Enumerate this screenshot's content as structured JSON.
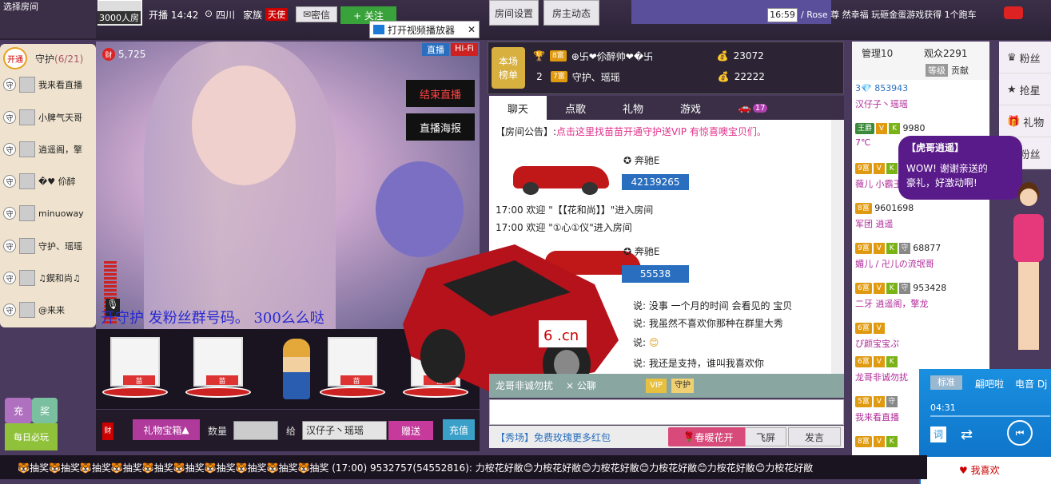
{
  "topbar": {
    "choose_room": "选择房间",
    "room_capacity": "3000人房",
    "live_time": "开播 14:42",
    "location": "四川",
    "family_label": "家族",
    "family_tag": "天使",
    "message_btn": "密信",
    "follow_btn": "+ 关注",
    "room_settings": "房间设置",
    "host_news": "房主动态",
    "clock": "16:59",
    "ticker": "/ Rose 尊 然幸福 玩砸金蛋游戏获得 1个跑车"
  },
  "player_popup": {
    "open_player": "打开视频播放器"
  },
  "guard": {
    "open_btn": "开通",
    "title": "守护",
    "count": "(6/21)",
    "members": [
      {
        "tag": "守",
        "name": "我来看直播"
      },
      {
        "tag": "守",
        "name": "小脾气天哥"
      },
      {
        "tag": "守",
        "name": "逍遥阁，擎"
      },
      {
        "tag": "守",
        "name": "�♥︎ 伱醉"
      },
      {
        "tag": "守",
        "name": "minuoway"
      },
      {
        "tag": "守",
        "name": "守护、瑶瑶"
      },
      {
        "tag": "守",
        "name": "♫鍥和尚♫"
      },
      {
        "tag": "守",
        "name": "@来来"
      }
    ]
  },
  "video": {
    "wealth_icon": "财",
    "wealth": "5,725",
    "live_badge": "直播",
    "hifi_badge": "Hi-Fi",
    "end_live": "结束直播",
    "live_poster": "直播海报",
    "subtitle": "开守护 发粉丝群号码。 300么么哒"
  },
  "gifts": {
    "items": [
      {
        "label": "苗"
      },
      {
        "label": "苗"
      },
      {
        "label": ""
      },
      {
        "label": "苗"
      },
      {
        "label": "苗"
      }
    ]
  },
  "controls": {
    "wealth_icon": "财",
    "gift_box": "礼物宝箱",
    "quantity_label": "数量",
    "to_label": "给",
    "recipient": "汉仔子丶瑶瑶",
    "send_btn": "赠送",
    "recharge_btn": "充值"
  },
  "left_small": {
    "recharge": "充",
    "lottery": "奖",
    "daily_play": "每日必玩"
  },
  "rank": {
    "title1": "本场",
    "title2": "榜单",
    "rows": [
      {
        "pos": "1",
        "level": "8富",
        "name": "⊕卐❤伱醉帅❤�卐",
        "coins": "23072"
      },
      {
        "pos": "2",
        "level": "7富",
        "name": "守护、瑶瑶",
        "coins": "22222"
      }
    ]
  },
  "tabs": [
    {
      "label": "聊天"
    },
    {
      "label": "点歌"
    },
    {
      "label": "礼物"
    },
    {
      "label": "游戏"
    },
    {
      "label": "17"
    }
  ],
  "chat": {
    "notice_prefix": "【房间公告】:",
    "notice": "点击这里找苗苗开通守护送VIP 有惊喜噢宝贝们。",
    "car1_name": "奔驰E",
    "car1_num": "42139265",
    "welcome1": "17:00 欢迎 \"【【花和尚】】\"进入房间",
    "welcome2": "17:00 欢迎 \"①心①仪\"进入房间",
    "car2_name": "奔驰E",
    "car2_num": "55538",
    "msg1": "说: 没事 一个月的时间 会看见的 宝贝",
    "msg2": "说: 我虽然不喜欢你那种在群里大秀",
    "msg3": "说:",
    "msg4": "说: 我还是支持，谁叫我喜欢你",
    "bar_user": "龙哥非诚勿扰",
    "bar_x": "× 公聊",
    "bar_vip": "VIP",
    "bar_guard": "守护",
    "show_text": "【秀场】免费玫瑰更多红包",
    "flower_btn": "春暖花开",
    "fly_btn": "飞屏",
    "send_btn": "发言"
  },
  "audience": {
    "manage_tab": "管理10",
    "viewers_tab": "观众2291",
    "level_tab": "等级",
    "contrib_tab": "贡献",
    "rows": [
      {
        "top": "3💎 853943",
        "name": "汉仔子丶瑶瑶"
      },
      {
        "level": "王爵",
        "num": "9980",
        "name": "7℃"
      },
      {
        "level": "9富",
        "num": "",
        "name": "薇儿 小霸王"
      },
      {
        "level": "8富",
        "num": "9601698",
        "name": "军团 逍遥"
      },
      {
        "level": "9富",
        "num": "68877",
        "name": "媚儿 / 卍儿の流氓哥"
      },
      {
        "level": "6富",
        "num": "953428",
        "name": "二牙 逍遥阁，擎龙"
      },
      {
        "level": "6富",
        "num": "",
        "name": "ぴ颜宝宝ぷ"
      },
      {
        "level": "6富",
        "num": "",
        "name": "龙哥非诚勿扰"
      },
      {
        "level": "5富",
        "num": "",
        "name": "我来看直播"
      },
      {
        "level": "8富",
        "num": "",
        "name": ""
      }
    ]
  },
  "side": {
    "items": [
      {
        "label": "粉丝"
      },
      {
        "label": "抢星"
      },
      {
        "label": "礼物"
      },
      {
        "label": "粉丝"
      }
    ]
  },
  "bubble": {
    "title": "【虎哥逍遥】",
    "line1": "WOW! 谢谢亲送的",
    "line2": "豪礼，好激动啊!"
  },
  "music": {
    "quality": "标准",
    "song1": "翩吧啦",
    "song2": "电音 Dj",
    "time": "04:31",
    "like": "我喜欢"
  },
  "marquee": {
    "text": "🐯抽奖🐯抽奖🐯抽奖🐯抽奖🐯抽奖🐯抽奖🐯抽奖🐯抽奖🐯抽奖🐯抽奖 (17:00)  9532757(54552816): 力桉花好敝😊力桉花好敝😊力桉花好敝😊力桉花好敝😊力桉花好敝😊力桉花好敝"
  }
}
